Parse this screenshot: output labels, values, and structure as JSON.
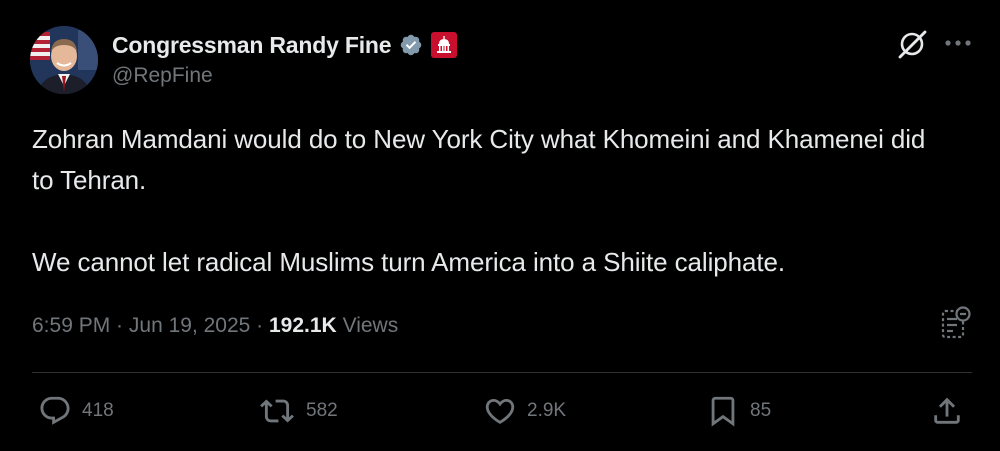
{
  "author": {
    "display_name": "Congressman Randy Fine",
    "handle": "@RepFine",
    "badges": [
      "verified-badge-icon",
      "government-affiliation-badge-icon"
    ]
  },
  "header_icons": [
    "grok-icon",
    "more-options-icon"
  ],
  "tweet": {
    "paragraphs": [
      "Zohran Mamdani would do to New York City what Khomeini and Khamenei did to Tehran.",
      "We cannot let radical Muslims turn America into a Shiite caliphate."
    ],
    "time": "6:59 PM",
    "separator": " · ",
    "date": "Jun 19, 2025",
    "views_count": "192.1K",
    "views_label": "Views"
  },
  "actions": {
    "reply": {
      "icon": "reply-icon",
      "count": "418"
    },
    "retweet": {
      "icon": "retweet-icon",
      "count": "582"
    },
    "like": {
      "icon": "like-icon",
      "count": "2.9K"
    },
    "bookmark": {
      "icon": "bookmark-icon",
      "count": "85"
    },
    "share": {
      "icon": "share-icon"
    }
  },
  "colors": {
    "background": "#000000",
    "text_primary": "#e7e9ea",
    "text_secondary": "#71767b",
    "divider": "#2f3336",
    "verified_badge": "#829aab",
    "affiliation_badge": "#c8102e"
  }
}
